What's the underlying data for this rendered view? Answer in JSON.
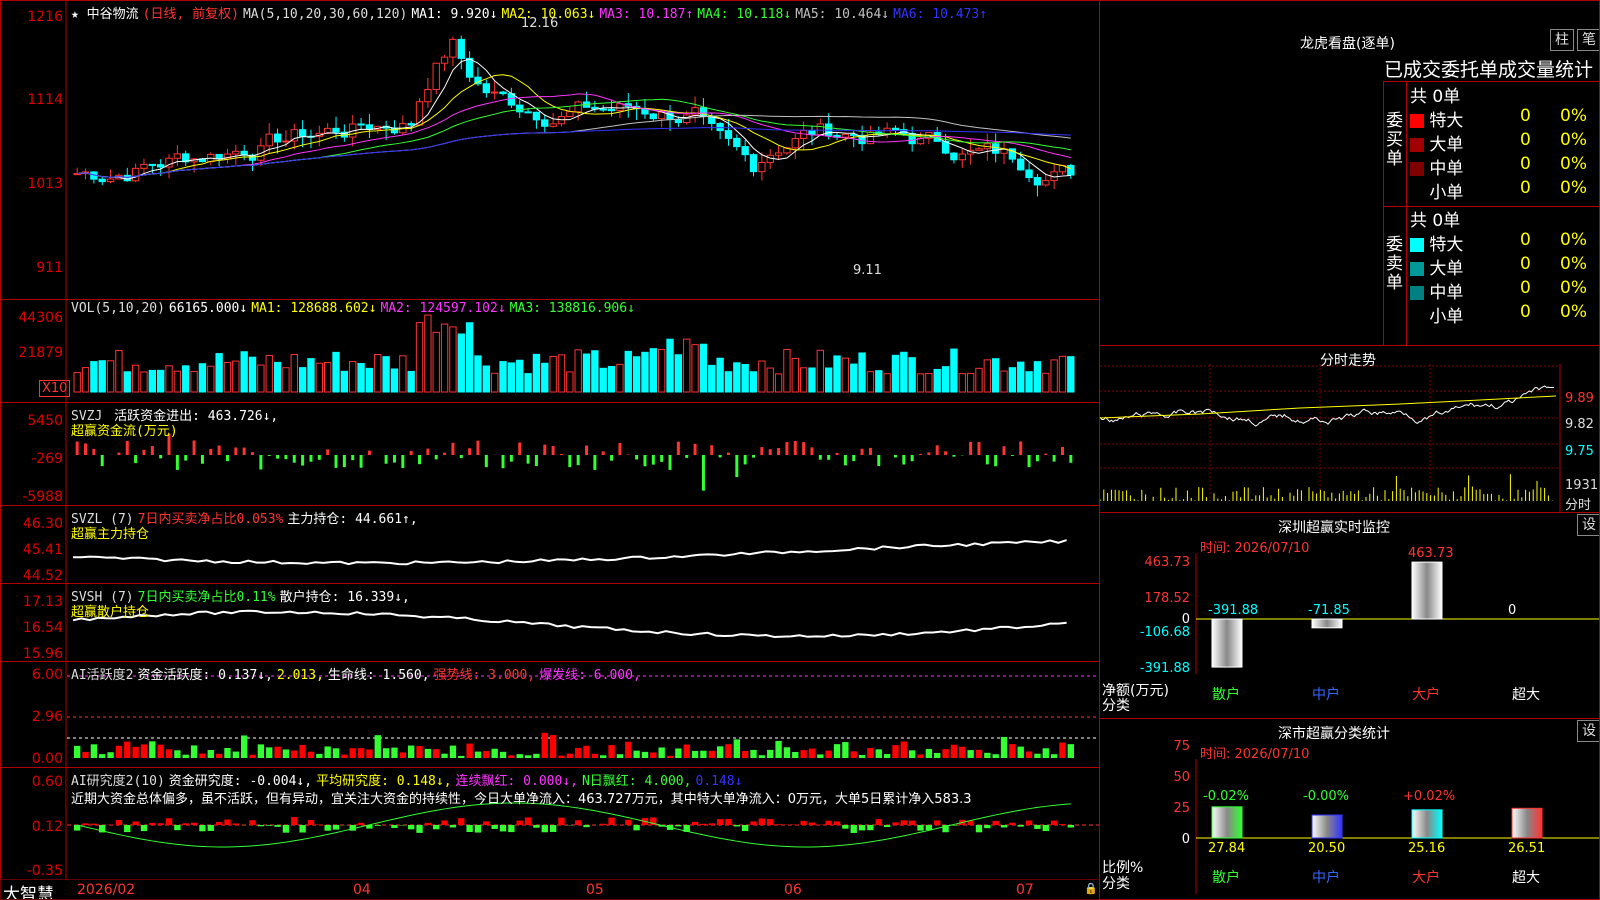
{
  "main": {
    "title": "★ 中谷物流",
    "mode": "(日线, 前复权)",
    "ma_label": "MA(5,10,20,30,60,120)",
    "ma": [
      {
        "t": "MA1: 9.920↓",
        "c": "#ffffff"
      },
      {
        "t": "MA2: 10.063↓",
        "c": "#ffff00"
      },
      {
        "t": "MA3: 10.187↑",
        "c": "#ff33ff"
      },
      {
        "t": "MA4: 10.118↓",
        "c": "#33ff33"
      },
      {
        "t": "MA5: 10.464↓",
        "c": "#c0c0c0"
      },
      {
        "t": "MA6: 10.473↑",
        "c": "#3333ff"
      }
    ],
    "axis": [
      "1216",
      "1114",
      "1013",
      "911"
    ],
    "high": "12.16",
    "low": "9.11"
  },
  "vol": {
    "label": "VOL(5,10,20)",
    "v": "66165.000↓",
    "ma": [
      {
        "t": "MA1: 128688.602↓",
        "c": "#ffff00"
      },
      {
        "t": "MA2: 124597.102↓",
        "c": "#ff33ff"
      },
      {
        "t": "MA3: 138816.906↓",
        "c": "#33ff33"
      }
    ],
    "axis": [
      "44306",
      "21879"
    ],
    "unit": "X10"
  },
  "svzj": {
    "l1": "SVZJ",
    "l2": "活跃资金进出: 463.726↓,",
    "l3": "超赢资金流(万元)",
    "axis": [
      "5450",
      "-269",
      "-5988"
    ]
  },
  "svzl": {
    "l1": "SVZL (7)",
    "l2": "7日内买卖净占比0.053%",
    "l3": "主力持仓: 44.661↑,",
    "l4": "超赢主力持仓",
    "axis": [
      "46.30",
      "45.41",
      "44.52"
    ]
  },
  "svsh": {
    "l1": "SVSH (7)",
    "l2": "7日内买卖净占比0.11%",
    "l3": "散户持仓: 16.339↓,",
    "l4": "超赢散户持仓",
    "axis": [
      "17.13",
      "16.54",
      "15.96"
    ]
  },
  "ai1": {
    "l1": "AI活跃度2",
    "l2": "资金活跃度: 0.137↓,",
    "l2b": "2.013,",
    "l3": "生命线: 1.560,",
    "l4": "强势线: 3.000,",
    "l5": "爆发线: 6.000,",
    "axis": [
      "6.00",
      "2.96",
      "0.00"
    ]
  },
  "ai2": {
    "l1": "AI研究度2(10)",
    "l2": "资金研究度: -0.004↓,",
    "l3": "平均研究度: 0.148↓,",
    "l4": "连续飘红: 0.000↓,",
    "l5": "N日飘红: 4.000,",
    "l6": "0.148↓",
    "msg": "近期大资金总体偏多，虽不活跃，但有异动，宜关注大资金的持续性，今日大单净流入：463.727万元，其中特大单净流入：0万元，大单5日累计净入583.3",
    "axis": [
      "0.60",
      "0.12",
      "-0.35"
    ]
  },
  "xaxis": {
    "brand": "大智慧",
    "labels": [
      "2026/02",
      "04",
      "05",
      "06",
      "07"
    ]
  },
  "right": {
    "lhkp": {
      "title": "龙虎看盘(逐单)",
      "btn1": "柱",
      "btn2": "笔",
      "sub": "已成交委托单成交量统计",
      "buy_total": "共 0单",
      "sell_total": "共 0单",
      "buy_side": "委买单",
      "sell_side": "委卖单",
      "buy": [
        {
          "n": "特大",
          "v": "0",
          "p": "0%",
          "c": "#ff0000"
        },
        {
          "n": "大单",
          "v": "0",
          "p": "0%",
          "c": "#a00000"
        },
        {
          "n": "中单",
          "v": "0",
          "p": "0%",
          "c": "#800000"
        },
        {
          "n": "小单",
          "v": "0",
          "p": "0%",
          "c": ""
        }
      ],
      "sell": [
        {
          "n": "特大",
          "v": "0",
          "p": "0%",
          "c": "#00ffff"
        },
        {
          "n": "大单",
          "v": "0",
          "p": "0%",
          "c": "#009999"
        },
        {
          "n": "中单",
          "v": "0",
          "p": "0%",
          "c": "#008080"
        },
        {
          "n": "小单",
          "v": "0",
          "p": "0%",
          "c": ""
        }
      ]
    },
    "fszs": {
      "title": "分时走势",
      "axis": [
        "9.89",
        "9.82",
        "9.75"
      ],
      "vol": "1931",
      "unit": "分时"
    },
    "szcy": {
      "title": "深圳超赢实时监控",
      "btn": "设",
      "time": "时间: 2026/07/10",
      "axis": [
        "463.73",
        "178.52",
        "0",
        "-106.68",
        "-391.88"
      ],
      "vals": [
        {
          "t": "-391.88",
          "v": -391.88
        },
        {
          "t": "-71.85",
          "v": -71.85
        },
        {
          "t": "463.73",
          "v": 463.73
        },
        {
          "t": "0",
          "v": 0
        }
      ],
      "cats": [
        "散户",
        "中户",
        "大户",
        "超大"
      ],
      "ylabel": "净额(万元)",
      "xlabel": "分类"
    },
    "sscy": {
      "title": "深市超赢分类统计",
      "btn": "设",
      "time": "时间: 2026/07/10",
      "axis": [
        "75",
        "50",
        "25",
        "0"
      ],
      "tops": [
        "-0.02%",
        "-0.00%",
        "+0.02%"
      ],
      "vals": [
        {
          "t": "27.84",
          "v": 27.84,
          "c": "#33ff33"
        },
        {
          "t": "20.50",
          "v": 20.5,
          "c": "#3333ff"
        },
        {
          "t": "25.16",
          "v": 25.16,
          "c": "#00ffff"
        },
        {
          "t": "26.51",
          "v": 26.51,
          "c": "#ff3333"
        }
      ],
      "cats": [
        "散户",
        "中户",
        "大户",
        "超大"
      ],
      "ylabel": "比例%",
      "xlabel": "分类"
    }
  }
}
